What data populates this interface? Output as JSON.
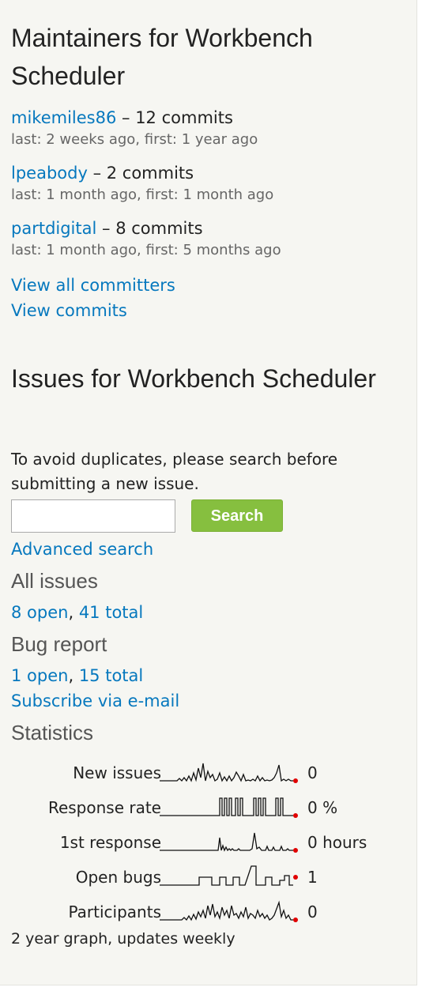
{
  "maintainers": {
    "title": "Maintainers for Workbench Scheduler",
    "items": [
      {
        "user": "mikemiles86",
        "commits": " – 12 commits",
        "dates": "last: 2 weeks ago, first: 1 year ago"
      },
      {
        "user": "lpeabody",
        "commits": " – 2 commits",
        "dates": "last: 1 month ago, first: 1 month ago"
      },
      {
        "user": "partdigital",
        "commits": " – 8 commits",
        "dates": "last: 1 month ago, first: 5 months ago"
      }
    ],
    "view_all_committers": "View all committers",
    "view_commits": "View commits"
  },
  "issues": {
    "title": "Issues for Workbench Scheduler",
    "avoid_text": "To avoid duplicates, please search before submitting a new issue.",
    "search_value": "",
    "search_button": "Search",
    "advanced_search": "Advanced search",
    "all_issues": {
      "heading": "All issues",
      "open": "8 open",
      "sep": ", ",
      "total": "41 total"
    },
    "bug_report": {
      "heading": "Bug report",
      "open": "1 open",
      "sep": ", ",
      "total": "15 total"
    },
    "subscribe": "Subscribe via e-mail",
    "statistics": {
      "heading": "Statistics",
      "rows": [
        {
          "label": "New issues",
          "value": "0"
        },
        {
          "label": "Response rate",
          "value": "0 %"
        },
        {
          "label": "1st response",
          "value": "0 hours"
        },
        {
          "label": "Open bugs",
          "value": "1"
        },
        {
          "label": "Participants",
          "value": "0"
        }
      ],
      "footnote": "2 year graph, updates weekly"
    }
  },
  "colors": {
    "link": "#0678be",
    "button": "#86bf3f",
    "sparkline_dot": "#e00000"
  }
}
